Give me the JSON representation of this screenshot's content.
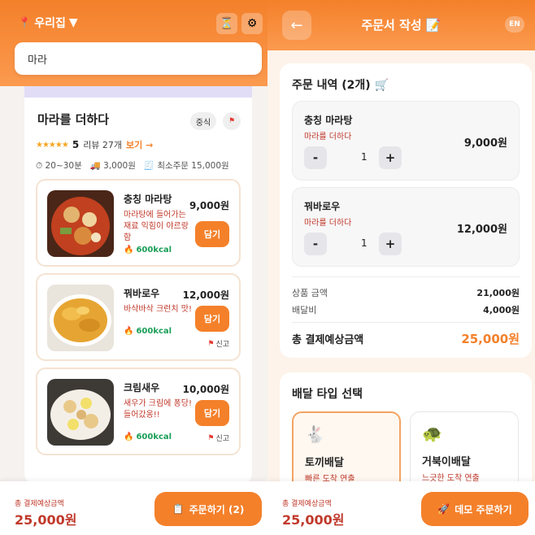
{
  "left": {
    "location": "우리집",
    "search_value": "마라",
    "store": {
      "name": "마라를 더하다",
      "tag": "중식",
      "rating": "5",
      "review_text": "리뷰 27개",
      "review_more": "보기 →",
      "time": "20~30분",
      "delivery_fee": "3,000원",
      "min_order": "최소주문 15,000원"
    },
    "menu": [
      {
        "name": "충칭 마라탕",
        "desc": "마라탕에 들어가는 재료 익힘이 야르랑 함",
        "kcal": "600kcal",
        "price": "9,000원",
        "button": "담기"
      },
      {
        "name": "꿔바로우",
        "desc": "바삭바삭 크런치 맛!",
        "kcal": "600kcal",
        "price": "12,000원",
        "button": "담기",
        "report": "신고"
      },
      {
        "name": "크림새우",
        "desc": "새우가 크림에 퐁당! 들어갔옹!!",
        "kcal": "600kcal",
        "price": "10,000원",
        "button": "담기",
        "report": "신고"
      }
    ],
    "footer": {
      "label": "총 결제예상금액",
      "amount": "25,000원",
      "button": "주문하기 (2)"
    }
  },
  "right": {
    "title": "주문서 작성 📝",
    "lang": "EN",
    "order_title": "주문 내역 (2개) 🛒",
    "items": [
      {
        "name": "충칭 마라탕",
        "store": "마라를 더하다",
        "qty": "1",
        "price": "9,000원"
      },
      {
        "name": "꿔바로우",
        "store": "마라를 더하다",
        "qty": "1",
        "price": "12,000원"
      }
    ],
    "summary": {
      "subtotal_label": "상품 금액",
      "subtotal": "21,000원",
      "delivery_label": "배달비",
      "delivery": "4,000원",
      "total_label": "총 결제예상금액",
      "total": "25,000원"
    },
    "delivery_title": "배달 타입 선택",
    "delivery_types": [
      {
        "name": "토끼배달",
        "desc": "빠른 도착 연출"
      },
      {
        "name": "거북이배달",
        "desc": "느긋한 도착 연출"
      }
    ],
    "footer": {
      "label": "총 결제예상금액",
      "amount": "25,000원",
      "button": "데모 주문하기"
    }
  },
  "colors": {
    "accent": "#f4802a",
    "price_text": "#c0392b",
    "kcal": "#1a9e57"
  }
}
